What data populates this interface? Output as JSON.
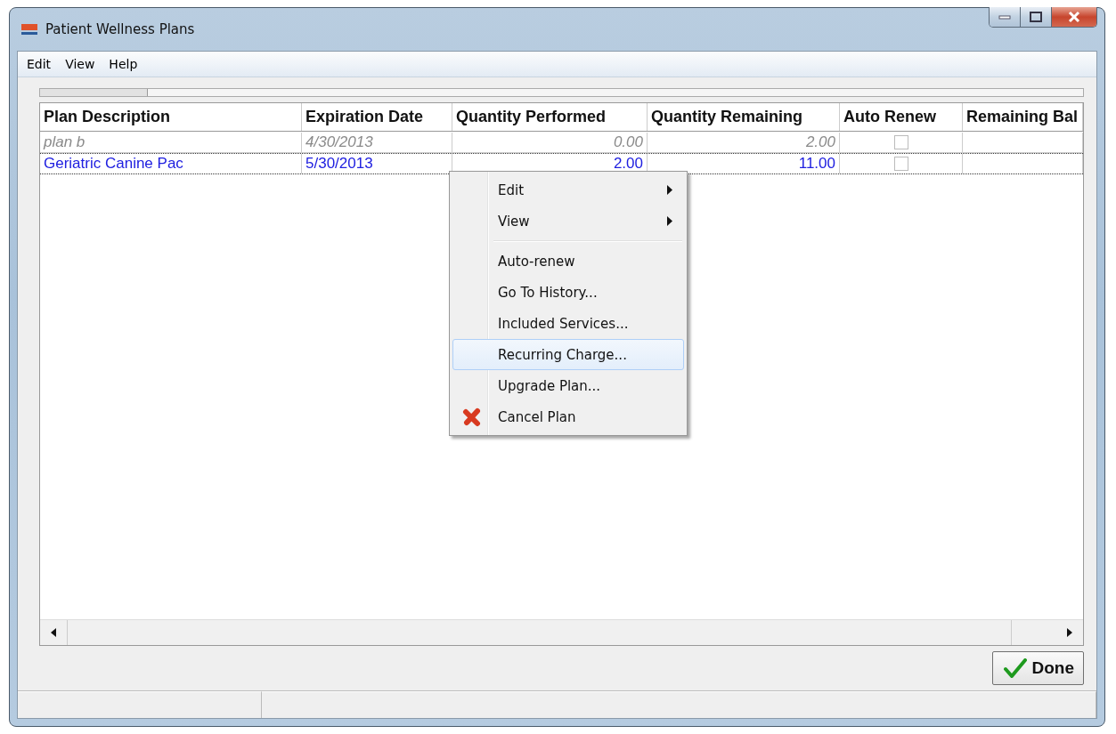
{
  "window": {
    "title": "Patient Wellness Plans"
  },
  "menu_bar": [
    "Edit",
    "View",
    "Help"
  ],
  "table": {
    "columns": [
      "Plan Description",
      "Expiration Date",
      "Quantity Performed",
      "Quantity Remaining",
      "Auto Renew",
      "Remaining Bal"
    ],
    "rows": [
      {
        "description": "plan b",
        "expiration": "4/30/2013",
        "performed": "0.00",
        "remaining": "2.00",
        "auto_renew": false,
        "inactive": true,
        "selected": false
      },
      {
        "description": "Geriatric Canine Pac",
        "expiration": "5/30/2013",
        "performed": "2.00",
        "remaining": "11.00",
        "auto_renew": false,
        "inactive": false,
        "selected": true
      }
    ]
  },
  "context_menu": {
    "items": [
      {
        "label": "Edit",
        "kind": "submenu",
        "selected": false
      },
      {
        "label": "View",
        "kind": "submenu",
        "selected": false
      },
      {
        "kind": "separator"
      },
      {
        "label": "Auto-renew",
        "kind": "command",
        "selected": false
      },
      {
        "label": "Go To History...",
        "kind": "command",
        "selected": false
      },
      {
        "label": "Included Services...",
        "kind": "command",
        "selected": false
      },
      {
        "label": "Recurring Charge...",
        "kind": "command",
        "selected": true
      },
      {
        "label": "Upgrade Plan...",
        "kind": "command",
        "selected": false
      },
      {
        "label": "Cancel Plan",
        "kind": "cancel",
        "selected": false
      }
    ]
  },
  "done_button": "Done"
}
